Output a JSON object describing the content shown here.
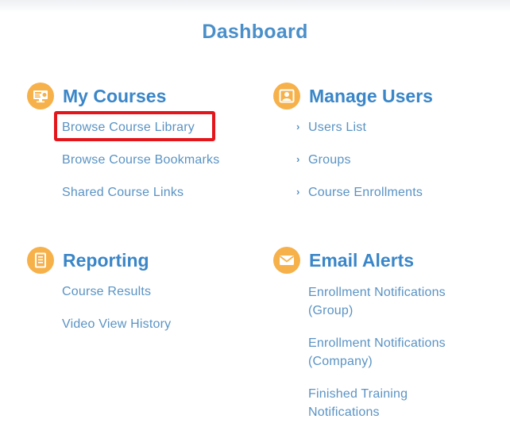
{
  "page": {
    "title": "Dashboard"
  },
  "sections": {
    "my_courses": {
      "title": "My Courses",
      "icon": "course-monitor-icon",
      "links": [
        "Browse Course Library",
        "Browse Course Bookmarks",
        "Shared Course Links"
      ]
    },
    "manage_users": {
      "title": "Manage Users",
      "icon": "user-badge-icon",
      "links": [
        "Users List",
        "Groups",
        "Course Enrollments"
      ]
    },
    "reporting": {
      "title": "Reporting",
      "icon": "report-document-icon",
      "links": [
        "Course Results",
        "Video View History"
      ]
    },
    "email_alerts": {
      "title": "Email Alerts",
      "icon": "envelope-icon",
      "links": [
        "Enrollment Notifications (Group)",
        "Enrollment Notifications (Company)",
        "Finished Training Notifications"
      ]
    }
  },
  "colors": {
    "accent": "#f6b14a",
    "heading": "#3a86c8",
    "link": "#5a93c4",
    "highlight": "#e4161c"
  }
}
